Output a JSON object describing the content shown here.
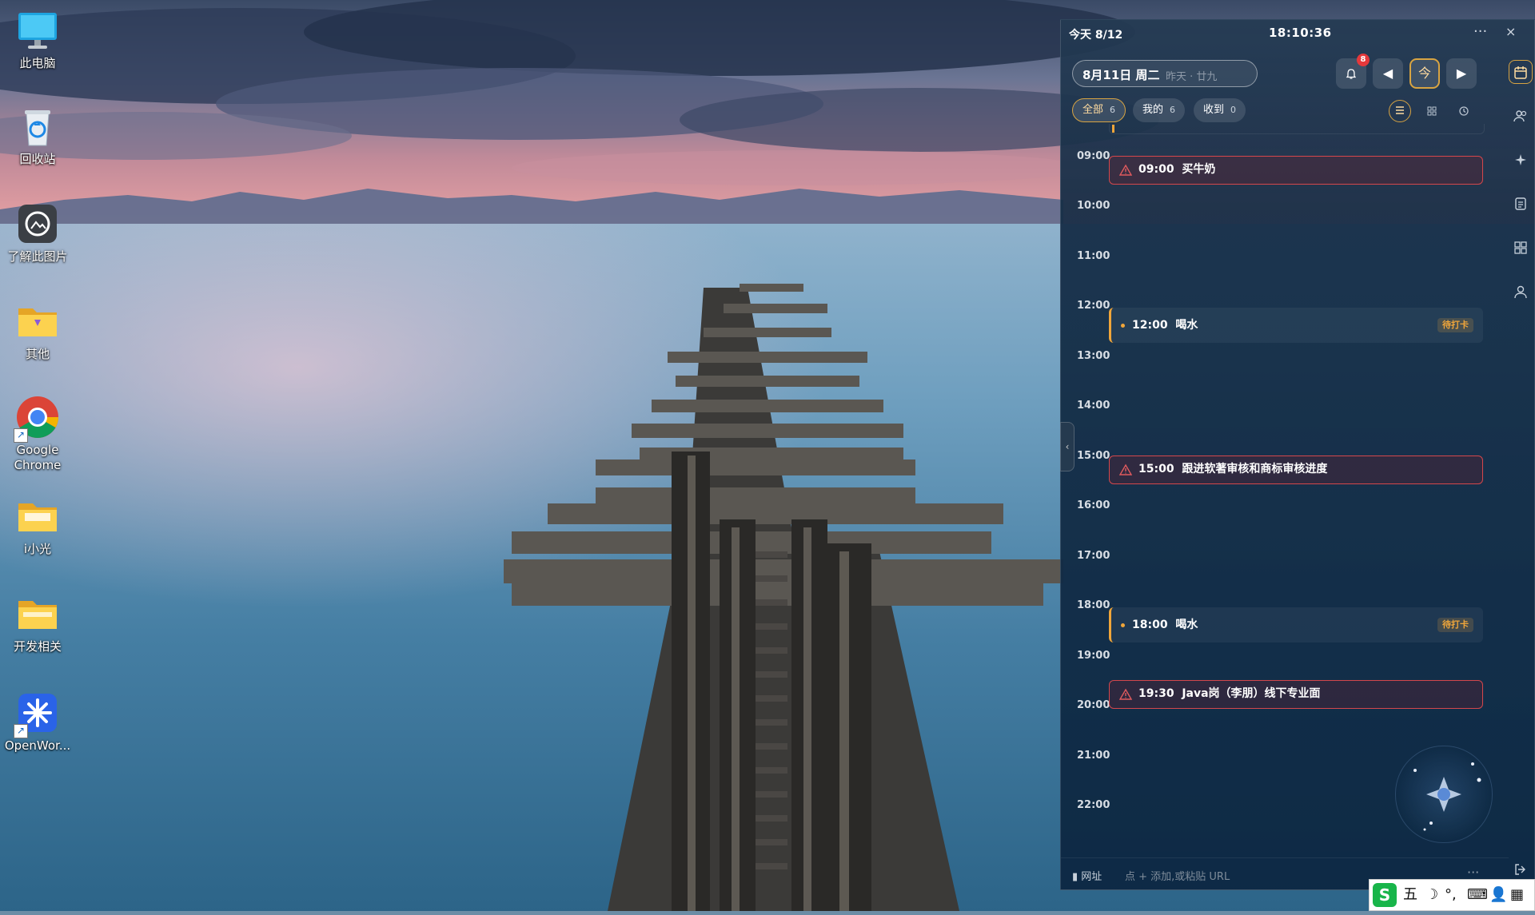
{
  "desktop": {
    "icons": [
      {
        "label": "此电脑",
        "icon": "monitor-icon"
      },
      {
        "label": "回收站",
        "icon": "recycle-bin-icon"
      },
      {
        "label": "了解此图片",
        "icon": "camera-icon"
      },
      {
        "label": "其他",
        "icon": "folder-icon"
      },
      {
        "label": "Google Chrome",
        "icon": "chrome-icon"
      },
      {
        "label": "i小光",
        "icon": "folder-icon"
      },
      {
        "label": "开发相关",
        "icon": "folder-icon"
      },
      {
        "label": "OpenWor...",
        "icon": "openwork-icon"
      }
    ]
  },
  "calendar": {
    "today_label": "今天 8/12",
    "clock": "18:10:36",
    "more": "···",
    "close": "×",
    "selected_date": "8月11日 周二",
    "lunar": "昨天 · 廿九",
    "notification_count": "8",
    "prev": "◀",
    "today_btn": "今",
    "next": "▶",
    "filters": [
      {
        "label": "全部",
        "count": "6"
      },
      {
        "label": "我的",
        "count": "6"
      },
      {
        "label": "收到",
        "count": "0"
      }
    ],
    "hours": [
      "09:00",
      "10:00",
      "11:00",
      "12:00",
      "13:00",
      "14:00",
      "15:00",
      "16:00",
      "17:00",
      "18:00",
      "19:00",
      "20:00",
      "21:00",
      "22:00"
    ],
    "events": [
      {
        "time": "09:00",
        "title": "买牛奶",
        "kind": "alarm"
      },
      {
        "time": "12:00",
        "title": "喝水",
        "kind": "checkin",
        "tag": "待打卡"
      },
      {
        "time": "15:00",
        "title": "跟进软著审核和商标审核进度",
        "kind": "alarm"
      },
      {
        "time": "18:00",
        "title": "喝水",
        "kind": "checkin",
        "tag": "待打卡"
      },
      {
        "time": "19:30",
        "title": "Java岗（李朋）线下专业面",
        "kind": "alarm"
      }
    ],
    "bookmark_label": "网址",
    "url_hint": "点 + 添加,或粘贴 URL",
    "bottom_more": "···",
    "collapse": "‹"
  },
  "ime": {
    "logo": "S",
    "mode": "五",
    "moon": "☽",
    "punct": "°,",
    "keyboard": "⌨",
    "user": "👤",
    "apps": "▦"
  },
  "colors": {
    "accent_gold": "#d8a442",
    "alarm_red": "#d4474c",
    "checkin_orange": "#f0a63a",
    "badge_red": "#e5383b"
  }
}
